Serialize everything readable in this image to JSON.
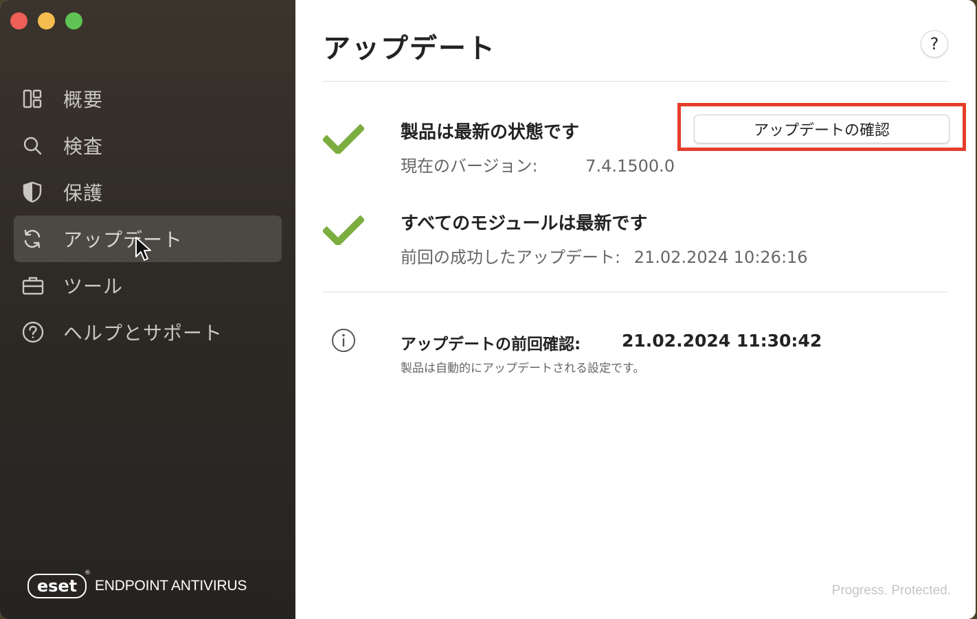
{
  "sidebar": {
    "items": [
      {
        "label": "概要",
        "icon": "overview-icon"
      },
      {
        "label": "検査",
        "icon": "search-icon"
      },
      {
        "label": "保護",
        "icon": "shield-icon"
      },
      {
        "label": "アップデート",
        "icon": "refresh-icon",
        "active": true
      },
      {
        "label": "ツール",
        "icon": "toolbox-icon"
      },
      {
        "label": "ヘルプとサポート",
        "icon": "help-circle-icon"
      }
    ],
    "brand_logo": "eset",
    "brand_text": "ENDPOINT ANTIVIRUS"
  },
  "main": {
    "title": "アップデート",
    "help_label": "?",
    "product_status": {
      "title": "製品は最新の状態です",
      "version_label": "現在のバージョン:",
      "version_value": "7.4.1500.0"
    },
    "check_button_label": "アップデートの確認",
    "modules_status": {
      "title": "すべてのモジュールは最新です",
      "last_success_label": "前回の成功したアップデート:",
      "last_success_value": "21.02.2024 10:26:16"
    },
    "last_check": {
      "label": "アップデートの前回確認:",
      "value": "21.02.2024 11:30:42",
      "note": "製品は自動的にアップデートされる設定です。"
    },
    "tagline": "Progress. Protected."
  },
  "colors": {
    "check_green": "#7cae3f",
    "highlight_red": "#e53d2a",
    "sidebar_active": "#4c4843"
  }
}
